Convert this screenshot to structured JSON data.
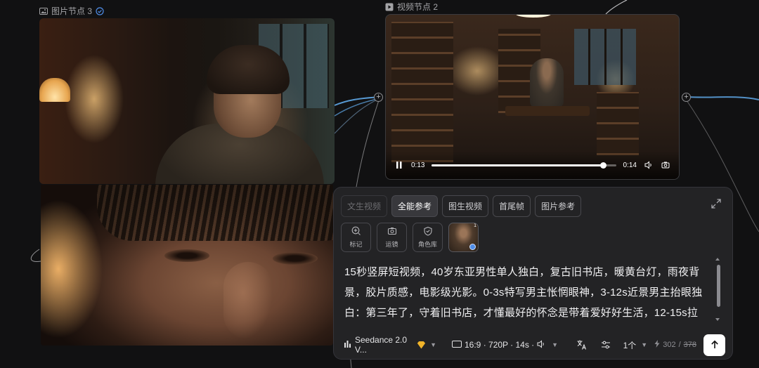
{
  "canvas": {
    "image_node": {
      "label": "图片节点 3",
      "label_icon": "image-icon",
      "verified_icon": "check-circle-icon"
    },
    "video_node": {
      "label": "视频节点 2",
      "label_icon": "video-icon",
      "current_time": "0:13",
      "duration": "0:14",
      "progress": 0.93
    }
  },
  "panel": {
    "tabs": [
      {
        "label": "文生视频",
        "state": "disabled"
      },
      {
        "label": "全能参考",
        "state": "active"
      },
      {
        "label": "图生视频",
        "state": "normal"
      },
      {
        "label": "首尾帧",
        "state": "normal"
      },
      {
        "label": "图片参考",
        "state": "normal"
      }
    ],
    "tools": [
      {
        "label": "标记",
        "icon": "mark-plus-icon"
      },
      {
        "label": "运镜",
        "icon": "camera-icon"
      },
      {
        "label": "角色库",
        "icon": "shield-check-icon"
      }
    ],
    "reference_thumb": {
      "count": "1"
    },
    "prompt": "15秒竖屏短视频，40岁东亚男性单人独白，复古旧书店，暖黄台灯，雨夜背景，胶片质感，电影级光影。0-3s特写男主怅惘眼神，3-12s近景男主抬眼独白：第三年了，守着旧书店，才懂最好的怀念是带着爱好好生活，12-15s拉",
    "footer": {
      "model": "Seedance 2.0 V...",
      "settings": "16:9 · 720P · 14s ·",
      "count": "1个",
      "credits_used": "302",
      "credits_total": "378",
      "credits_separator": "/"
    }
  },
  "colors": {
    "accent_blue": "#4f8de8",
    "panel_bg": "#232325",
    "canvas_bg": "#111112",
    "gem": "#f0b32a"
  }
}
